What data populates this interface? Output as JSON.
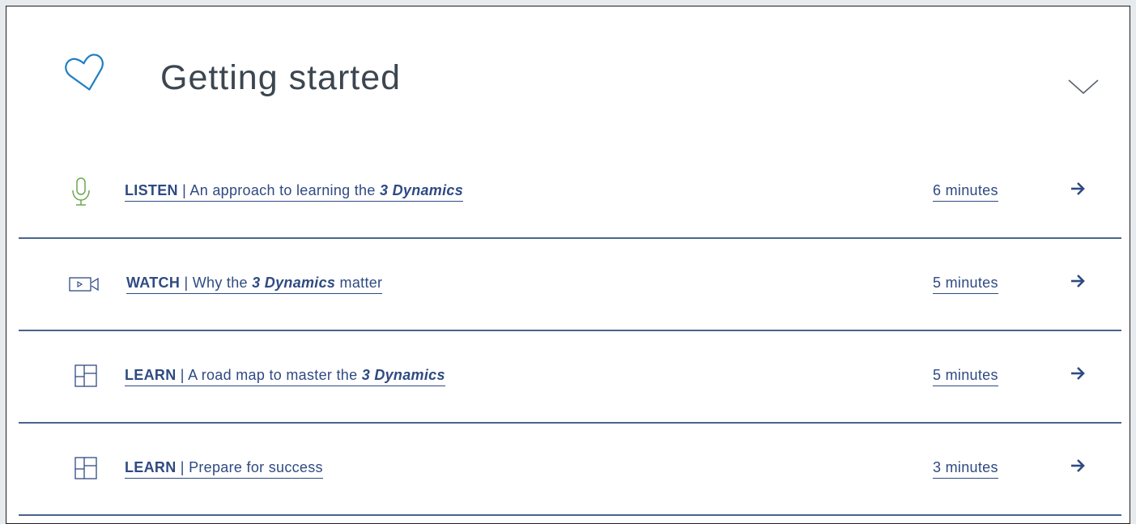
{
  "header": {
    "title": "Getting started",
    "icon": "heart-outline-icon",
    "toggle_icon": "chevron-down-icon"
  },
  "colors": {
    "link": "#2f4a82",
    "divider": "#4a648c",
    "heart": "#1e7fc3",
    "mic": "#6aa84f",
    "title": "#3c4650"
  },
  "items": [
    {
      "icon": "microphone-icon",
      "kind": "LISTEN",
      "separator": " | ",
      "text_before": "An approach to learning the ",
      "emphasis": "3 Dynamics",
      "text_after": "",
      "duration": "6 minutes"
    },
    {
      "icon": "video-camera-icon",
      "kind": "WATCH",
      "separator": " | ",
      "text_before": "Why the ",
      "emphasis": "3 Dynamics",
      "text_after": " matter",
      "duration": "5 minutes"
    },
    {
      "icon": "layout-grid-icon",
      "kind": "LEARN",
      "separator": " | ",
      "text_before": "A road map to master the ",
      "emphasis": "3 Dynamics",
      "text_after": "",
      "duration": "5 minutes"
    },
    {
      "icon": "layout-grid-icon",
      "kind": "LEARN",
      "separator": " | ",
      "text_before": "Prepare for success",
      "emphasis": "",
      "text_after": "",
      "duration": "3 minutes"
    }
  ]
}
